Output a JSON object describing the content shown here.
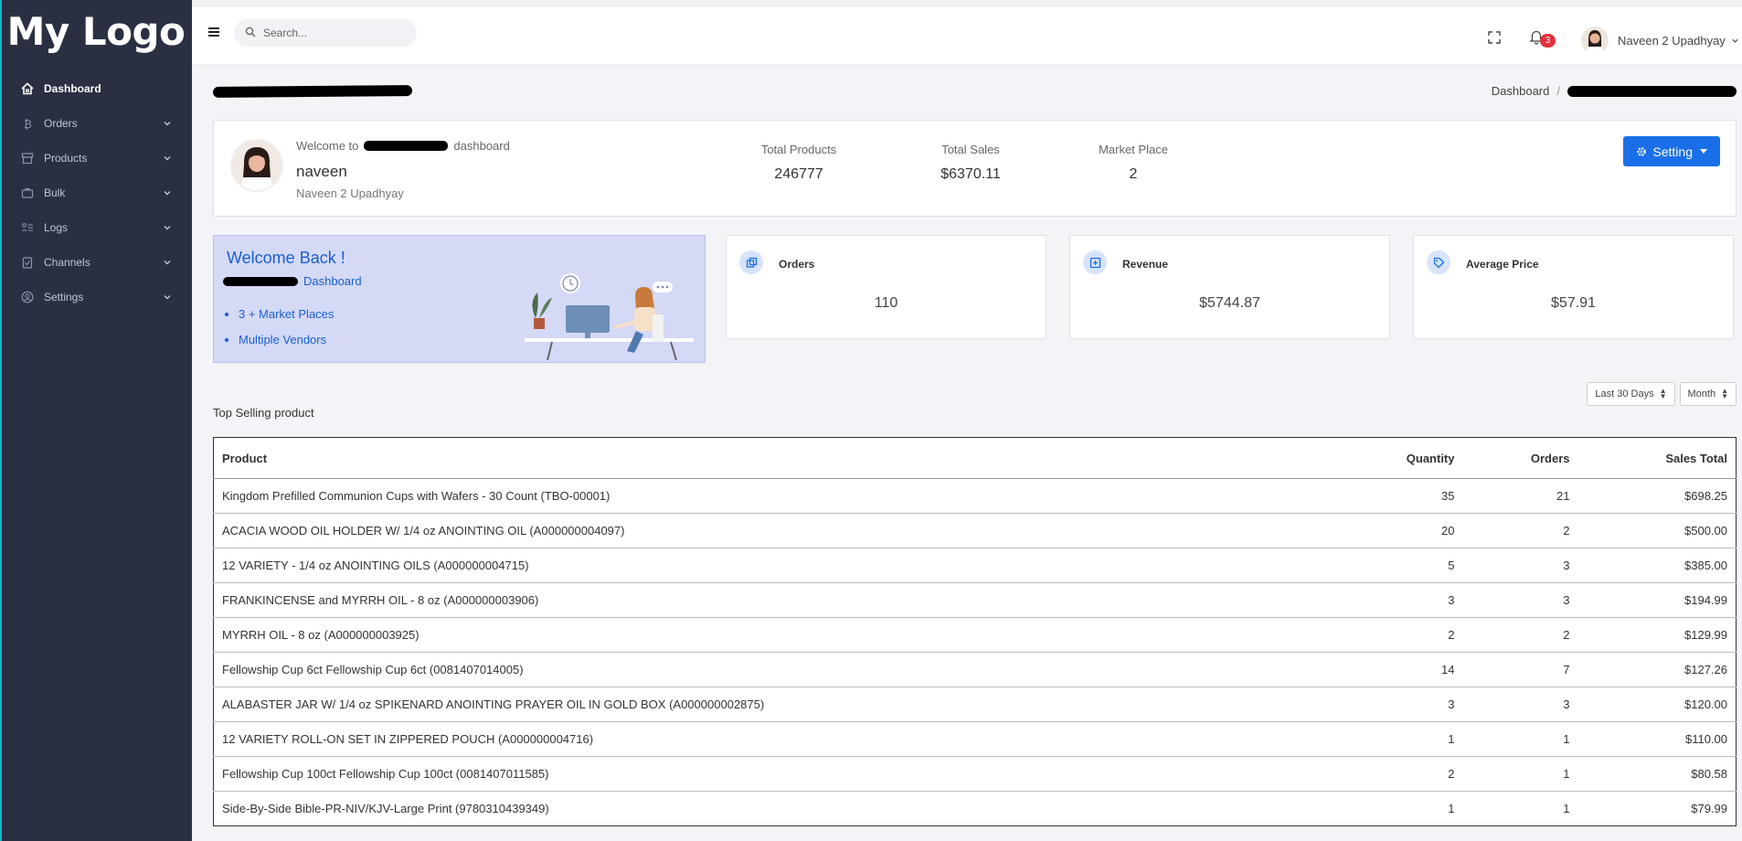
{
  "sidebar": {
    "logo": "My Logo",
    "items": [
      {
        "label": "Dashboard",
        "icon": "home-icon"
      },
      {
        "label": "Orders",
        "icon": "bitcoin-icon"
      },
      {
        "label": "Products",
        "icon": "store-icon"
      },
      {
        "label": "Bulk",
        "icon": "briefcase-icon"
      },
      {
        "label": "Logs",
        "icon": "list-icon"
      },
      {
        "label": "Channels",
        "icon": "clipboard-icon"
      },
      {
        "label": "Settings",
        "icon": "user-circle-icon"
      }
    ]
  },
  "header": {
    "search_placeholder": "Search...",
    "notification_count": "3",
    "user_name": "Naveen 2 Upadhyay"
  },
  "breadcrumb": {
    "home": "Dashboard",
    "sep": "/"
  },
  "profile": {
    "welcome_prefix": "Welcome to",
    "welcome_suffix": "dashboard",
    "username": "naveen",
    "full_name": "Naveen 2 Upadhyay",
    "stats": [
      {
        "label": "Total Products",
        "value": "246777"
      },
      {
        "label": "Total Sales",
        "value": "$6370.11"
      },
      {
        "label": "Market Place",
        "value": "2"
      }
    ],
    "setting_label": "Setting"
  },
  "welcome_banner": {
    "title": "Welcome Back !",
    "subtitle": "Dashboard",
    "bullets": [
      "3 + Market Places",
      "Multiple Vendors"
    ]
  },
  "cards": [
    {
      "label": "Orders",
      "value": "110",
      "icon": "copy-icon"
    },
    {
      "label": "Revenue",
      "value": "$5744.87",
      "icon": "archive-icon"
    },
    {
      "label": "Average Price",
      "value": "$57.91",
      "icon": "tag-icon"
    }
  ],
  "filters": {
    "range": "Last 30 Days",
    "period": "Month"
  },
  "table": {
    "title": "Top Selling product",
    "headers": [
      "Product",
      "Quantity",
      "Orders",
      "Sales Total"
    ],
    "rows": [
      [
        "Kingdom Prefilled Communion Cups with Wafers - 30 Count (TBO-00001)",
        "35",
        "21",
        "$698.25"
      ],
      [
        "ACACIA WOOD OIL HOLDER W/ 1/4 oz ANOINTING OIL (A000000004097)",
        "20",
        "2",
        "$500.00"
      ],
      [
        "12 VARIETY - 1/4 oz ANOINTING OILS (A000000004715)",
        "5",
        "3",
        "$385.00"
      ],
      [
        "FRANKINCENSE and MYRRH OIL - 8 oz (A000000003906)",
        "3",
        "3",
        "$194.99"
      ],
      [
        "MYRRH OIL - 8 oz (A000000003925)",
        "2",
        "2",
        "$129.99"
      ],
      [
        "Fellowship Cup 6ct Fellowship Cup 6ct (0081407014005)",
        "14",
        "7",
        "$127.26"
      ],
      [
        "ALABASTER JAR W/ 1/4 oz SPIKENARD ANOINTING PRAYER OIL IN GOLD BOX (A000000002875)",
        "3",
        "3",
        "$120.00"
      ],
      [
        "12 VARIETY ROLL-ON SET IN ZIPPERED POUCH (A000000004716)",
        "1",
        "1",
        "$110.00"
      ],
      [
        "Fellowship Cup 100ct Fellowship Cup 100ct (0081407011585)",
        "2",
        "1",
        "$80.58"
      ],
      [
        "Side-By-Side Bible-PR-NIV/KJV-Large Print (9780310439349)",
        "1",
        "1",
        "$79.99"
      ]
    ]
  },
  "colors": {
    "sidebar": "#2a3042",
    "primary": "#1a6fe8",
    "banner": "#d4d9f6",
    "badge": "#e0313b"
  }
}
